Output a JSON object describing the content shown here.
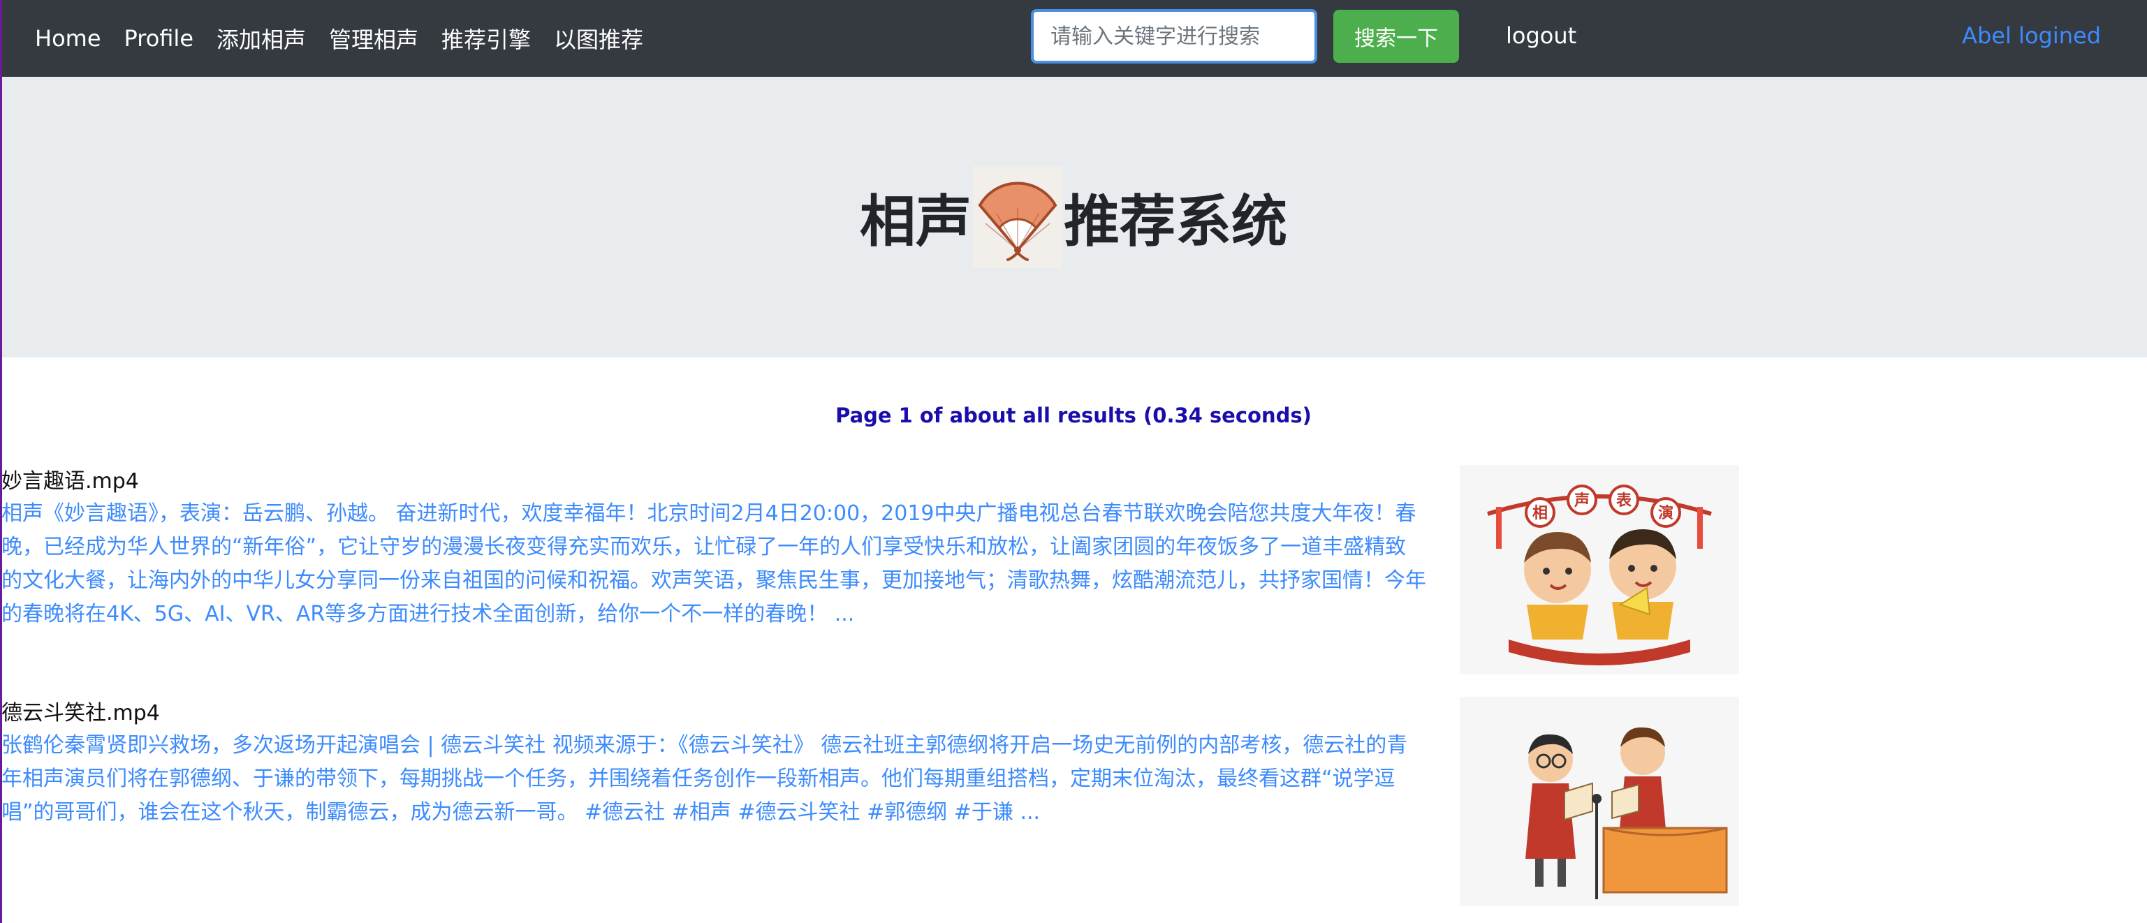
{
  "navbar": {
    "links": [
      "Home",
      "Profile",
      "添加相声",
      "管理相声",
      "推荐引擎",
      "以图推荐"
    ],
    "search_placeholder": "请输入关键字进行搜索",
    "search_button": "搜索一下",
    "logout": "logout",
    "user": "Abel logined"
  },
  "hero": {
    "title_left": "相声",
    "title_right": "推荐系统"
  },
  "results_meta": "Page 1 of about all results (0.34 seconds)",
  "results": [
    {
      "title": "妙言趣语.mp4",
      "description": "相声《妙言趣语》，表演：岳云鹏、孙越。 奋进新时代，欢度幸福年！北京时间2月4日20:00，2019中央广播电视总台春节联欢晚会陪您共度大年夜！春晚，已经成为华人世界的“新年俗”，它让守岁的漫漫长夜变得充实而欢乐，让忙碌了一年的人们享受快乐和放松，让阖家团圆的年夜饭多了一道丰盛精致的文化大餐，让海内外的中华儿女分享同一份来自祖国的问候和祝福。欢声笑语，聚焦民生事，更加接地气；清歌热舞，炫酷潮流范儿，共抒家国情！今年的春晚将在4K、5G、AI、VR、AR等多方面进行技术全面创新，给你一个不一样的春晚！ ...",
      "thumb_banner": "相声表演"
    },
    {
      "title": "德云斗笑社.mp4",
      "description": "张鹤伦秦霄贤即兴救场，多次返场开起演唱会 | 德云斗笑社 视频来源于：《德云斗笑社》 德云社班主郭德纲将开启一场史无前例的内部考核，德云社的青年相声演员们将在郭德纲、于谦的带领下，每期挑战一个任务，并围绕着任务创作一段新相声。他们每期重组搭档，定期末位淘汰，最终看这群“说学逗唱”的哥哥们，谁会在这个秋天，制霸德云，成为德云新一哥。 #德云社 #相声 #德云斗笑社 #郭德纲 #于谦 ..."
    }
  ],
  "colors": {
    "navbar_bg": "#343a40",
    "search_button": "#4cae4c",
    "link_blue": "#3d8bfd",
    "meta_blue": "#1a0dab",
    "hero_bg": "#e9ecef"
  },
  "icons": [
    "fan-icon",
    "crosstalk-duo-illustration",
    "crosstalk-stage-illustration"
  ]
}
